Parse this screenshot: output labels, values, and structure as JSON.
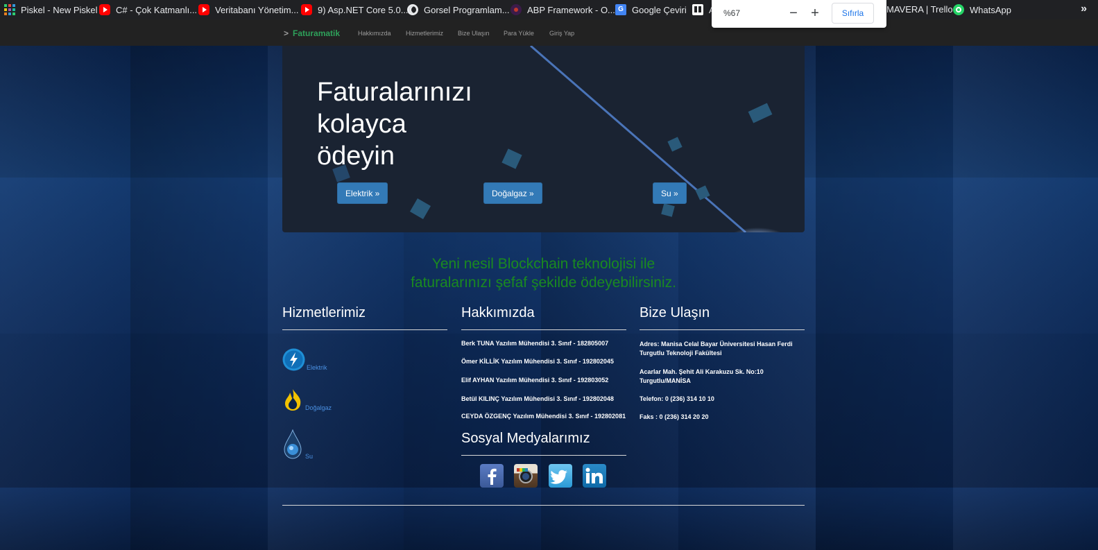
{
  "bookmarks": [
    {
      "label": "Piskel - New Piskel",
      "icon": "piskel-icon"
    },
    {
      "label": "C# - Çok Katmanlı...",
      "icon": "youtube-icon"
    },
    {
      "label": "Veritabanı Yönetim...",
      "icon": "youtube-icon"
    },
    {
      "label": "9) Asp.NET Core 5.0...",
      "icon": "youtube-icon"
    },
    {
      "label": "Gorsel Programlam...",
      "icon": "globe-icon"
    },
    {
      "label": "ABP Framework - O...",
      "icon": "abp-icon"
    },
    {
      "label": "Google Çeviri",
      "icon": "google-translate-icon"
    },
    {
      "label": "A",
      "icon": "trello-icon"
    },
    {
      "label": "MAVERA | Trello",
      "icon": ""
    },
    {
      "label": "WhatsApp",
      "icon": "whatsapp-icon"
    }
  ],
  "bookmarks_more": "»",
  "zoom": {
    "value": "%67",
    "minus": "−",
    "plus": "+",
    "reset": "Sıfırla"
  },
  "navbar": {
    "brand_chevron": ">",
    "brand": "Faturamatik",
    "links": [
      "Hakkımızda",
      "Hizmetlerimiz",
      "Bize Ulaşın",
      "Para Yükle",
      "Giriş Yap"
    ]
  },
  "hero": {
    "title_lines": [
      "Faturalarınızı",
      "kolayca",
      "ödeyin"
    ],
    "buttons": [
      "Elektrik »",
      "Doğalgaz »",
      "Su »"
    ]
  },
  "tagline": [
    "Yeni nesil Blockchain teknolojisi ile",
    "faturalarınızı şefaf şekilde ödeyebilirsiniz."
  ],
  "services": {
    "title": "Hizmetlerimiz",
    "items": [
      {
        "label": "Elektrik",
        "icon": "lightning-icon"
      },
      {
        "label": "Doğalgaz",
        "icon": "flame-icon"
      },
      {
        "label": "Su",
        "icon": "water-drop-icon"
      }
    ]
  },
  "about": {
    "title": "Hakkımızda",
    "members": [
      "Berk TUNA Yazılım Mühendisi 3. Sınıf - 182805007",
      "Ömer KİLLİK Yazılım Mühendisi 3. Sınıf - 192802045",
      "Elif AYHAN Yazılım Mühendisi 3. Sınıf - 192803052",
      "Betül KILINÇ Yazılım Mühendisi 3. Sınıf - 192802048",
      "CEYDA ÖZGENÇ Yazılım Mühendisi 3. Sınıf - 192802081"
    ]
  },
  "contact": {
    "title": "Bize Ulaşın",
    "lines": [
      "Adres: Manisa Celal Bayar Üniversitesi Hasan Ferdi Turgutlu Teknoloji Fakültesi",
      "Acarlar Mah. Şehit Ali Karakuzu Sk. No:10 Turgutlu/MANİSA",
      "Telefon: 0 (236) 314 10 10",
      "Faks : 0 (236) 314 20 20"
    ]
  },
  "social": {
    "title": "Sosyal Medyalarımız",
    "items": [
      "facebook",
      "instagram",
      "twitter",
      "linkedin"
    ]
  }
}
